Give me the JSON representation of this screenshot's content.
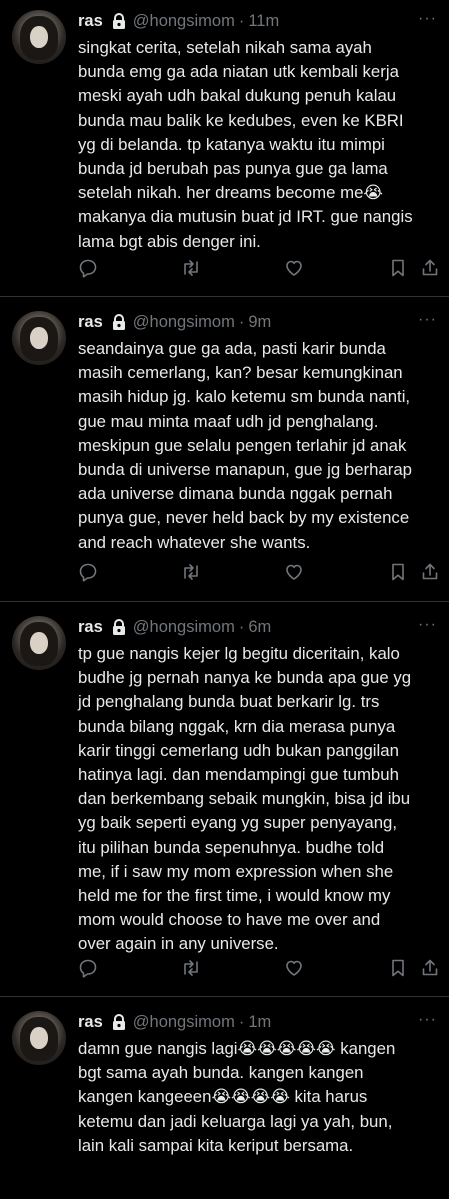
{
  "tweets": [
    {
      "name": "ras",
      "handle": "@hongsimom",
      "separator": "·",
      "time": "11m",
      "text": "singkat cerita, setelah nikah sama ayah\nbunda emg ga ada niatan utk kembali kerja\nmeski ayah udh bakal dukung penuh kalau\nbunda mau balik ke kedubes, even ke KBRI\nyg di belanda. tp katanya waktu itu mimpi\nbunda jd berubah pas punya gue ga lama\nsetelah nikah. her dreams become me😭\nmakanya dia mutusin buat jd IRT. gue nangis\nlama bgt abis denger ini."
    },
    {
      "name": "ras",
      "handle": "@hongsimom",
      "separator": "·",
      "time": "9m",
      "text": "seandainya gue ga ada, pasti karir bunda\nmasih cemerlang, kan? besar kemungkinan\nmasih hidup jg. kalo ketemu sm bunda nanti,\ngue mau minta maaf udh jd penghalang.\nmeskipun gue selalu pengen terlahir jd anak\nbunda di universe manapun, gue jg berharap\nada universe dimana bunda nggak pernah\npunya gue, never held back by my existence\nand reach whatever she wants."
    },
    {
      "name": "ras",
      "handle": "@hongsimom",
      "separator": "·",
      "time": "6m",
      "text": "tp gue nangis kejer lg begitu diceritain, kalo\nbudhe jg pernah nanya ke bunda apa gue yg\njd penghalang bunda buat berkarir lg. trs\nbunda bilang nggak, krn dia merasa punya\nkarir tinggi cemerlang udh bukan panggilan\nhatinya lagi. dan mendampingi gue tumbuh\ndan berkembang sebaik mungkin, bisa jd ibu\nyg baik seperti eyang yg super penyayang,\nitu pilihan bunda sepenuhnya. budhe told\nme, if i saw my mom expression when she\nheld me for the first time, i would know my\nmom would choose to have me over and\nover again in any universe."
    },
    {
      "name": "ras",
      "handle": "@hongsimom",
      "separator": "·",
      "time": "1m",
      "text": "damn gue nangis lagi😭😭😭😭😭 kangen\nbgt sama ayah bunda. kangen kangen\nkangen kangeeen😭😭😭😭 kita harus\nketemu dan jadi keluarga lagi ya yah, bun,\nlain kali sampai kita keriput bersama."
    }
  ],
  "more_label": "···",
  "icons": {
    "lock": "lock-icon",
    "reply": "reply-icon",
    "retweet": "retweet-icon",
    "like": "heart-icon",
    "bookmark": "bookmark-icon",
    "share": "share-icon"
  },
  "colors": {
    "background": "#000000",
    "text": "#e7e9ea",
    "secondary": "#71767b",
    "divider": "#2f3336"
  }
}
